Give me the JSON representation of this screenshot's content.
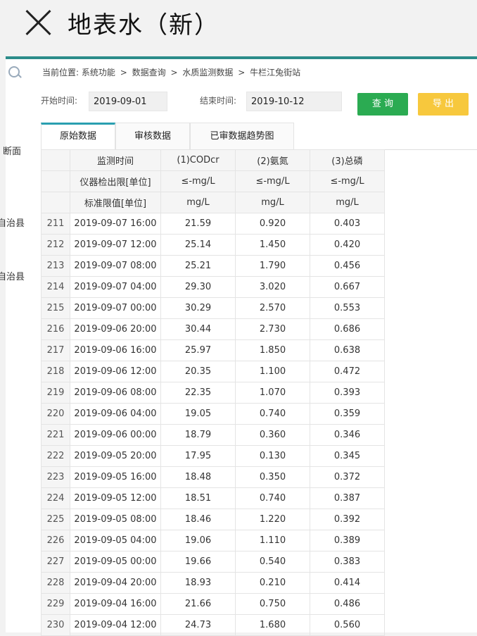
{
  "window": {
    "title": "地表水（新）"
  },
  "sidebar": {
    "labels": [
      "断面",
      "自治县",
      "自治县"
    ]
  },
  "breadcrumb": {
    "prefix": "当前位置:",
    "items": [
      "系统功能",
      "数据查询",
      "水质监测数据",
      "牛栏江兔街站"
    ],
    "separator": ">"
  },
  "filters": {
    "start_label": "开始时间:",
    "start_value": "2019-09-01",
    "end_label": "结束时间:",
    "end_value": "2019-10-12"
  },
  "buttons": {
    "query": "查 询",
    "export": "导 出"
  },
  "colors": {
    "accent": "#2c8c8a",
    "query": "#2bab52",
    "export": "#f7c83d",
    "tab_active": "#2a9fb0"
  },
  "tabs": [
    {
      "label": "原始数据",
      "active": true
    },
    {
      "label": "审核数据",
      "active": false
    },
    {
      "label": "已审数据趋势图",
      "active": false
    }
  ],
  "table": {
    "header_rows": [
      [
        "",
        "监测时间",
        "(1)CODcr",
        "(2)氨氮",
        "(3)总磷"
      ],
      [
        "",
        "仪器检出限[单位]",
        "≤-mg/L",
        "≤-mg/L",
        "≤-mg/L"
      ],
      [
        "",
        "标准限值[单位]",
        "mg/L",
        "mg/L",
        "mg/L"
      ]
    ],
    "rows": [
      [
        "211",
        "2019-09-07 16:00",
        "21.59",
        "0.920",
        "0.403"
      ],
      [
        "212",
        "2019-09-07 12:00",
        "25.14",
        "1.450",
        "0.420"
      ],
      [
        "213",
        "2019-09-07 08:00",
        "25.21",
        "1.790",
        "0.456"
      ],
      [
        "214",
        "2019-09-07 04:00",
        "29.30",
        "3.020",
        "0.667"
      ],
      [
        "215",
        "2019-09-07 00:00",
        "30.29",
        "2.570",
        "0.553"
      ],
      [
        "216",
        "2019-09-06 20:00",
        "30.44",
        "2.730",
        "0.686"
      ],
      [
        "217",
        "2019-09-06 16:00",
        "25.97",
        "1.850",
        "0.638"
      ],
      [
        "218",
        "2019-09-06 12:00",
        "20.35",
        "1.100",
        "0.472"
      ],
      [
        "219",
        "2019-09-06 08:00",
        "22.35",
        "1.070",
        "0.393"
      ],
      [
        "220",
        "2019-09-06 04:00",
        "19.05",
        "0.740",
        "0.359"
      ],
      [
        "221",
        "2019-09-06 00:00",
        "18.79",
        "0.360",
        "0.346"
      ],
      [
        "222",
        "2019-09-05 20:00",
        "17.95",
        "0.130",
        "0.345"
      ],
      [
        "223",
        "2019-09-05 16:00",
        "18.48",
        "0.350",
        "0.372"
      ],
      [
        "224",
        "2019-09-05 12:00",
        "18.51",
        "0.740",
        "0.387"
      ],
      [
        "225",
        "2019-09-05 08:00",
        "18.46",
        "1.220",
        "0.392"
      ],
      [
        "226",
        "2019-09-05 04:00",
        "19.06",
        "1.110",
        "0.389"
      ],
      [
        "227",
        "2019-09-05 00:00",
        "19.66",
        "0.540",
        "0.383"
      ],
      [
        "228",
        "2019-09-04 20:00",
        "18.93",
        "0.210",
        "0.414"
      ],
      [
        "229",
        "2019-09-04 16:00",
        "21.66",
        "0.750",
        "0.486"
      ],
      [
        "230",
        "2019-09-04 12:00",
        "24.73",
        "1.680",
        "0.560"
      ]
    ]
  }
}
